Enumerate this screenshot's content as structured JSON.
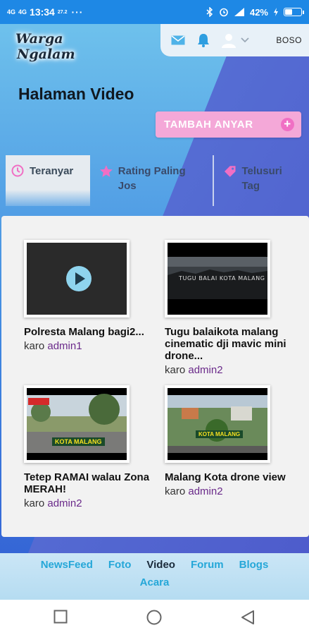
{
  "status_bar": {
    "signal_1": "4G",
    "signal_2": "4G",
    "time": "13:34",
    "data_rate": "27.2",
    "dots": "···",
    "battery": "42%",
    "battery_level": 0.42,
    "icons": [
      "bluetooth-icon",
      "alarm-icon",
      "signal-icon",
      "battery-icon"
    ]
  },
  "header": {
    "logo_line1": "Warga",
    "logo_line2": "Ngalam",
    "language": "BOSO",
    "icons": [
      "mail-icon",
      "bell-icon",
      "user-icon",
      "chevron-down-icon"
    ]
  },
  "page": {
    "title": "Halaman Video",
    "add_button": "TAMBAH ANYAR"
  },
  "tabs": [
    {
      "label": "Teranyar",
      "icon": "clock-icon"
    },
    {
      "label": "Rating Paling Jos",
      "icon": "star-icon"
    },
    {
      "label": "Telusuri Tag",
      "icon": "tag-icon"
    }
  ],
  "videos": [
    {
      "title": "Polresta Malang bagi2...",
      "by": "karo",
      "author": "admin1",
      "thumb_text": ""
    },
    {
      "title": "Tugu balaikota malang cinematic dji mavic mini drone...",
      "by": "karo",
      "author": "admin2",
      "thumb_text": "TUGU BALAI KOTA MALANG"
    },
    {
      "title": "Tetep RAMAI walau Zona MERAH!",
      "by": "karo",
      "author": "admin2",
      "thumb_text": "KOTA MALANG"
    },
    {
      "title": "Malang Kota drone view",
      "by": "karo",
      "author": "admin2",
      "thumb_text": "KOTA MALANG"
    }
  ],
  "bottom_nav": [
    "NewsFeed",
    "Foto",
    "Video",
    "Forum",
    "Blogs",
    "Acara"
  ],
  "colors": {
    "status_bar": "#1e88e5",
    "accent_pink": "#f4a8d8",
    "nav_link": "#25a7d8",
    "author": "#6a2a8a"
  }
}
